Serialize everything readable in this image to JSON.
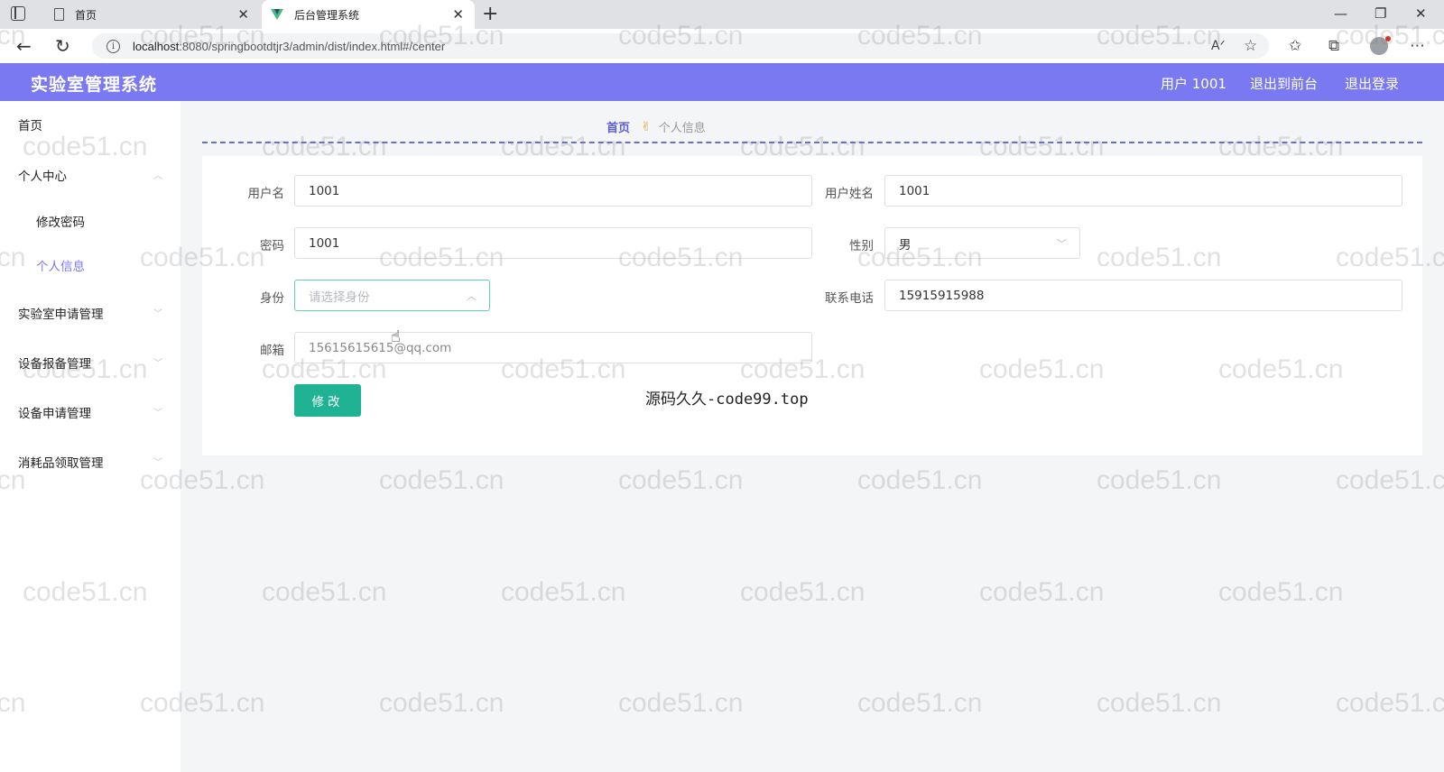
{
  "browser": {
    "tabs": [
      {
        "title": "首页"
      },
      {
        "title": "后台管理系统"
      }
    ],
    "url_host": "localhost",
    "url_rest": ":8080/springbootdtjr3/admin/dist/index.html#/center"
  },
  "header": {
    "title": "实验室管理系统",
    "user_label": "用户 1001",
    "to_front": "退出到前台",
    "logout": "退出登录"
  },
  "sidebar": {
    "items": [
      {
        "label": "首页"
      },
      {
        "label": "个人中心"
      },
      {
        "label": "修改密码"
      },
      {
        "label": "个人信息"
      },
      {
        "label": "实验室申请管理"
      },
      {
        "label": "设备报备管理"
      },
      {
        "label": "设备申请管理"
      },
      {
        "label": "消耗品领取管理"
      }
    ]
  },
  "breadcrumb": {
    "home": "首页",
    "current": "个人信息"
  },
  "form": {
    "username_label": "用户名",
    "username_value": "1001",
    "realname_label": "用户姓名",
    "realname_value": "1001",
    "password_label": "密码",
    "password_value": "1001",
    "gender_label": "性别",
    "gender_value": "男",
    "role_label": "身份",
    "role_placeholder": "请选择身份",
    "phone_label": "联系电话",
    "phone_value": "15915915988",
    "email_label": "邮箱",
    "email_value": "15615615615@qq.com",
    "submit_label": "修改"
  },
  "overlay_text": "源码久久-code99.top",
  "watermark_text": "code51.cn",
  "colors": {
    "header_bg": "#7a79f2",
    "submit_bg": "#1fb394",
    "active_menu": "#7a79f2"
  }
}
